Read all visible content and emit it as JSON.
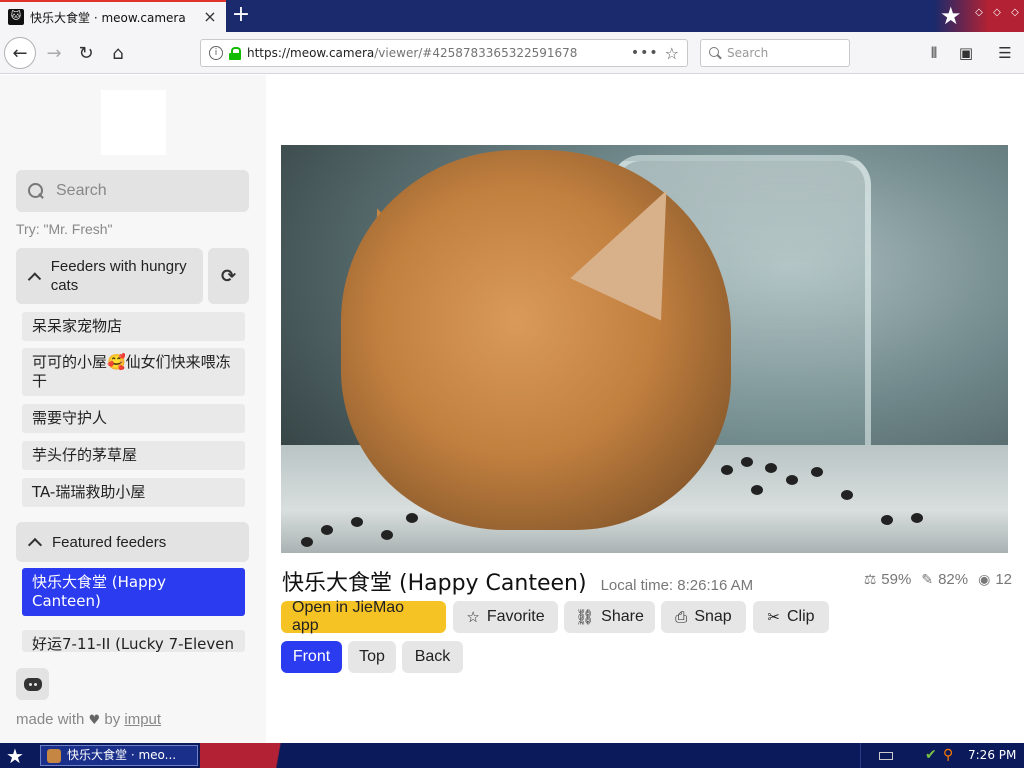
{
  "browser": {
    "tab_title": "快乐大食堂 · meow.camera",
    "tab_favicon": "cat",
    "url_host": "https://meow.camera",
    "url_path": "/viewer/#4258783365322591678",
    "search_placeholder": "Search"
  },
  "sidebar": {
    "search_placeholder": "Search",
    "hint": "Try: \"Mr. Fresh\"",
    "groups": [
      {
        "label": "Feeders with hungry cats",
        "items": [
          "呆呆家宠物店",
          "可可的小屋🥰仙女们快来喂冻干",
          "需要守护人",
          "芋头仔的茅草屋",
          "TA-瑞瑞救助小屋"
        ]
      },
      {
        "label": "Featured feeders",
        "items": [
          "快乐大食堂 (Happy Canteen)",
          "好运7-11-II (Lucky 7-Eleven"
        ]
      }
    ],
    "credits_prefix": "made with",
    "credits_by": "by",
    "credits_author": "imput"
  },
  "camera": {
    "title": "快乐大食堂 (Happy Canteen)",
    "local_time": "Local time: 8:26:16 AM",
    "stats": {
      "food": "59%",
      "treats": "82%",
      "viewers": "12"
    },
    "actions": {
      "open_app": "Open in JieMao app",
      "favorite": "Favorite",
      "share": "Share",
      "snap": "Snap",
      "clip": "Clip"
    },
    "views": {
      "front": "Front",
      "top": "Top",
      "back": "Back"
    }
  },
  "taskbar": {
    "task_title": "快乐大食堂 · meo...",
    "clock": "7:26 PM"
  },
  "colors": {
    "accent_blue": "#2b3bf0",
    "accent_yellow": "#f6c324",
    "tab_accent": "#e0332b"
  }
}
